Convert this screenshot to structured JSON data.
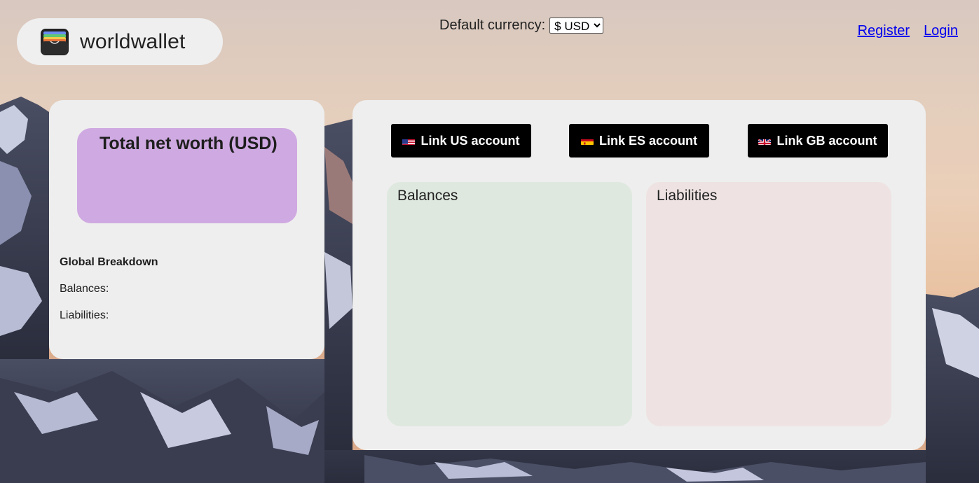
{
  "brand": {
    "name": "worldwallet",
    "icon": "wallet-icon"
  },
  "currency": {
    "label": "Default currency:",
    "selected": "$ USD"
  },
  "auth": {
    "register": "Register",
    "login": "Login"
  },
  "summary": {
    "networth_title": "Total net worth (USD)",
    "breakdown_heading": "Global Breakdown",
    "balances_label": "Balances:",
    "liabilities_label": "Liabilities:"
  },
  "accounts": {
    "buttons": [
      {
        "label": "Link US account",
        "flag": "us-flag-icon"
      },
      {
        "label": "Link ES account",
        "flag": "es-flag-icon"
      },
      {
        "label": "Link GB account",
        "flag": "gb-flag-icon"
      }
    ],
    "balances_title": "Balances",
    "liabilities_title": "Liabilities"
  },
  "colors": {
    "networth_box": "#cfa9e1",
    "balances_panel": "#dee8df",
    "liabilities_panel": "#eee3e2",
    "card": "#eeeeee",
    "link": "#0000ee"
  }
}
